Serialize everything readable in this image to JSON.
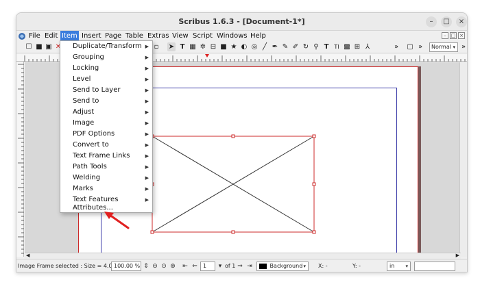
{
  "window": {
    "title": "Scribus 1.6.3 - [Document-1*]",
    "minimize_glyph": "–",
    "maximize_glyph": "□",
    "close_glyph": "×"
  },
  "menubar": {
    "items": [
      "File",
      "Edit",
      "Item",
      "Insert",
      "Page",
      "Table",
      "Extras",
      "View",
      "Script",
      "Windows",
      "Help"
    ],
    "active": "Item"
  },
  "toolbar": {
    "overflow_glyph": "»",
    "mode_combo": "Normal"
  },
  "item_menu": {
    "items": [
      {
        "label": "Duplicate/Transform",
        "submenu": true
      },
      {
        "label": "Grouping",
        "submenu": true
      },
      {
        "label": "Locking",
        "submenu": true
      },
      {
        "label": "Level",
        "submenu": true
      },
      {
        "label": "Send to Layer",
        "submenu": true
      },
      {
        "label": "Send to",
        "submenu": true
      },
      {
        "label": "Adjust",
        "submenu": true
      },
      {
        "label": "Image",
        "submenu": true
      },
      {
        "label": "PDF Options",
        "submenu": true
      },
      {
        "label": "Convert to",
        "submenu": true
      },
      {
        "label": "Text Frame Links",
        "submenu": true
      },
      {
        "label": "Path Tools",
        "submenu": true
      },
      {
        "label": "Welding",
        "submenu": true
      },
      {
        "label": "Marks",
        "submenu": true
      },
      {
        "label": "Text Features",
        "submenu": true
      },
      {
        "label": "Attributes...",
        "submenu": false
      }
    ],
    "submenu_glyph": "▶"
  },
  "statusbar": {
    "selection_info": "Image Frame selected : Size = 4.05",
    "zoom": "100.00 %",
    "page_number": "1",
    "page_of": "of 1",
    "layer": "Background",
    "x_label": "X:  -",
    "y_label": "Y:  -",
    "unit": "in"
  },
  "colors": {
    "menu_highlight": "#3b7ddd",
    "page_border": "#cc2a2a",
    "margin_guide": "#3a3aa8",
    "annotation_arrow": "#e02020"
  }
}
